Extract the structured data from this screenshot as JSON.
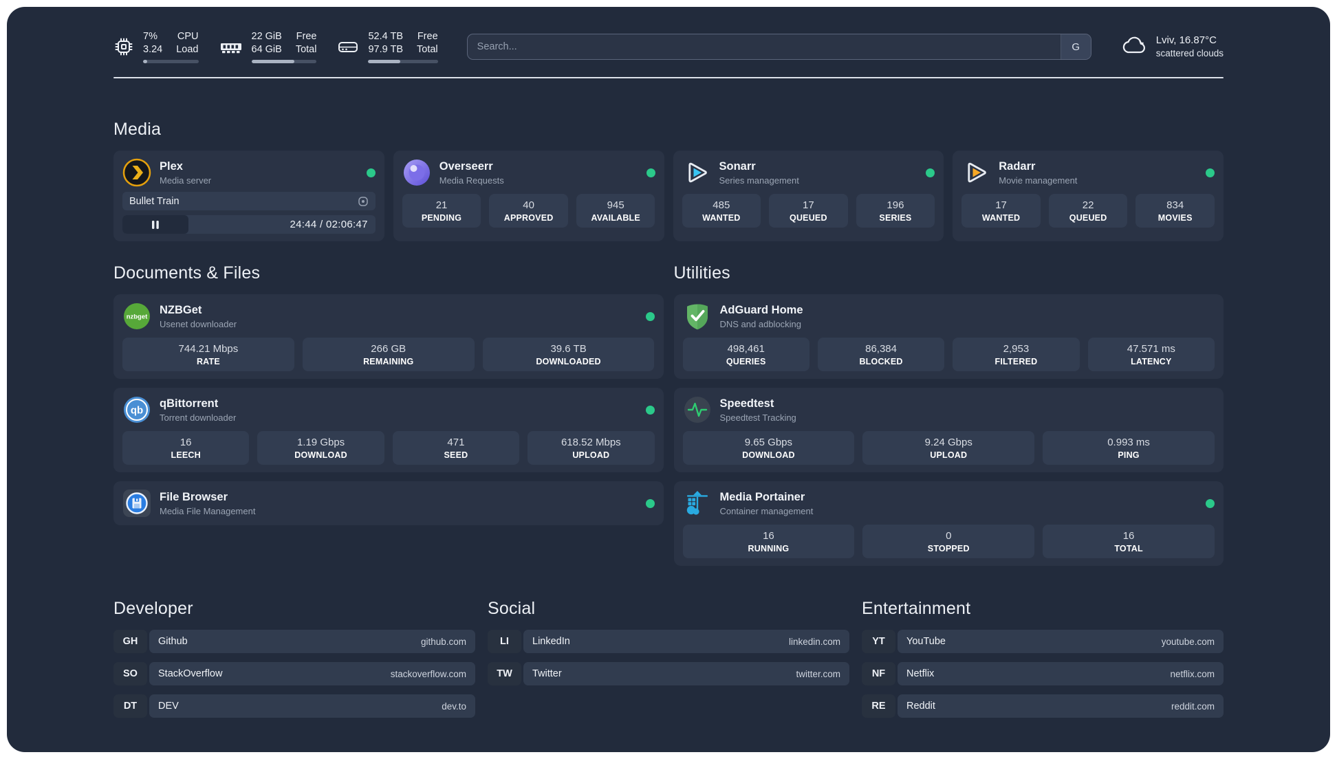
{
  "colors": {
    "background": "#222b3c",
    "card": "#2a3345",
    "tile": "#323d51",
    "online_dot": "#2bc98a",
    "divider": "#dde2ea",
    "plex_accent": "#e5a00d",
    "overseerr_accent": "#7c6ee8",
    "sonarr_accent": "#38c6f4",
    "radarr_accent": "#f7a825",
    "nzbget_accent": "#57a839",
    "qbittorrent_accent": "#4a8fd4",
    "adguard_accent": "#63b566",
    "speedtest_accent": "#2ecc71",
    "filebrowser_accent": "#2a7de1",
    "portainer_accent": "#29aae1"
  },
  "header": {
    "system": [
      {
        "icon": "cpu-icon",
        "top_value": "7%",
        "bottom_value": "3.24",
        "top_label": "CPU",
        "bottom_label": "Load",
        "progress_pct": 8
      },
      {
        "icon": "memory-icon",
        "top_value": "22 GiB",
        "bottom_value": "64 GiB",
        "top_label": "Free",
        "bottom_label": "Total",
        "progress_pct": 66
      },
      {
        "icon": "disk-icon",
        "top_value": "52.4 TB",
        "bottom_value": "97.9 TB",
        "top_label": "Free",
        "bottom_label": "Total",
        "progress_pct": 46
      }
    ],
    "search": {
      "placeholder": "Search...",
      "button_label": "G"
    },
    "weather": {
      "location": "Lviv, 16.87°C",
      "condition": "scattered clouds"
    }
  },
  "media": {
    "title": "Media",
    "cards": [
      {
        "title": "Plex",
        "subtitle": "Media server",
        "online": true,
        "now_playing": {
          "title": "Bullet Train",
          "time": "24:44 / 02:06:47"
        }
      },
      {
        "title": "Overseerr",
        "subtitle": "Media Requests",
        "online": true,
        "stats": [
          {
            "value": "21",
            "label": "PENDING"
          },
          {
            "value": "40",
            "label": "APPROVED"
          },
          {
            "value": "945",
            "label": "AVAILABLE"
          }
        ]
      },
      {
        "title": "Sonarr",
        "subtitle": "Series management",
        "online": true,
        "stats": [
          {
            "value": "485",
            "label": "WANTED"
          },
          {
            "value": "17",
            "label": "QUEUED"
          },
          {
            "value": "196",
            "label": "SERIES"
          }
        ]
      },
      {
        "title": "Radarr",
        "subtitle": "Movie management",
        "online": true,
        "stats": [
          {
            "value": "17",
            "label": "WANTED"
          },
          {
            "value": "22",
            "label": "QUEUED"
          },
          {
            "value": "834",
            "label": "MOVIES"
          }
        ]
      }
    ]
  },
  "documents": {
    "title": "Documents & Files",
    "cards": [
      {
        "title": "NZBGet",
        "subtitle": "Usenet downloader",
        "online": true,
        "stats": [
          {
            "value": "744.21 Mbps",
            "label": "RATE"
          },
          {
            "value": "266 GB",
            "label": "REMAINING"
          },
          {
            "value": "39.6 TB",
            "label": "DOWNLOADED"
          }
        ]
      },
      {
        "title": "qBittorrent",
        "subtitle": "Torrent downloader",
        "online": true,
        "stats": [
          {
            "value": "16",
            "label": "LEECH"
          },
          {
            "value": "1.19 Gbps",
            "label": "DOWNLOAD"
          },
          {
            "value": "471",
            "label": "SEED"
          },
          {
            "value": "618.52 Mbps",
            "label": "UPLOAD"
          }
        ]
      },
      {
        "title": "File Browser",
        "subtitle": "Media File Management",
        "online": true
      }
    ]
  },
  "utilities": {
    "title": "Utilities",
    "cards": [
      {
        "title": "AdGuard Home",
        "subtitle": "DNS and adblocking",
        "stats": [
          {
            "value": "498,461",
            "label": "QUERIES"
          },
          {
            "value": "86,384",
            "label": "BLOCKED"
          },
          {
            "value": "2,953",
            "label": "FILTERED"
          },
          {
            "value": "47.571 ms",
            "label": "LATENCY"
          }
        ]
      },
      {
        "title": "Speedtest",
        "subtitle": "Speedtest Tracking",
        "stats": [
          {
            "value": "9.65 Gbps",
            "label": "DOWNLOAD"
          },
          {
            "value": "9.24 Gbps",
            "label": "UPLOAD"
          },
          {
            "value": "0.993 ms",
            "label": "PING"
          }
        ]
      },
      {
        "title": "Media Portainer",
        "subtitle": "Container management",
        "online": true,
        "stats": [
          {
            "value": "16",
            "label": "RUNNING"
          },
          {
            "value": "0",
            "label": "STOPPED"
          },
          {
            "value": "16",
            "label": "TOTAL"
          }
        ]
      }
    ]
  },
  "links": [
    {
      "title": "Developer",
      "items": [
        {
          "abbr": "GH",
          "name": "Github",
          "url": "github.com"
        },
        {
          "abbr": "SO",
          "name": "StackOverflow",
          "url": "stackoverflow.com"
        },
        {
          "abbr": "DT",
          "name": "DEV",
          "url": "dev.to"
        }
      ]
    },
    {
      "title": "Social",
      "items": [
        {
          "abbr": "LI",
          "name": "LinkedIn",
          "url": "linkedin.com"
        },
        {
          "abbr": "TW",
          "name": "Twitter",
          "url": "twitter.com"
        }
      ]
    },
    {
      "title": "Entertainment",
      "items": [
        {
          "abbr": "YT",
          "name": "YouTube",
          "url": "youtube.com"
        },
        {
          "abbr": "NF",
          "name": "Netflix",
          "url": "netflix.com"
        },
        {
          "abbr": "RE",
          "name": "Reddit",
          "url": "reddit.com"
        }
      ]
    }
  ]
}
